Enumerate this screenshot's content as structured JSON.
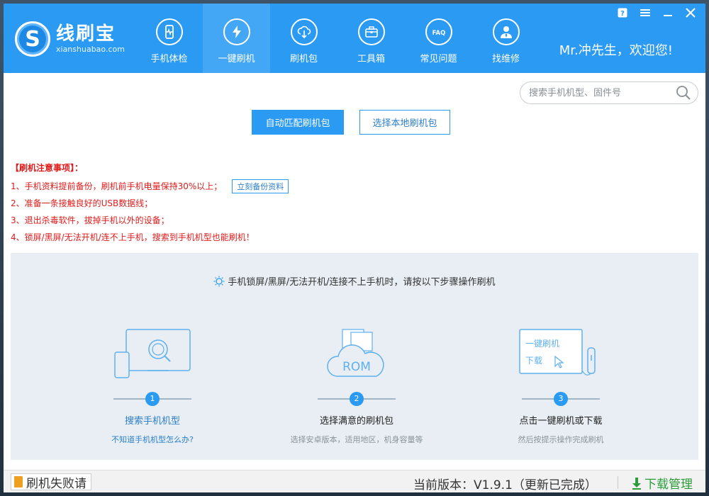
{
  "app": {
    "logo_name": "线刷宝",
    "logo_url": "xianshuabao.com",
    "welcome": "Mr.冲先生，欢迎您!"
  },
  "nav": [
    {
      "label": "手机体检",
      "icon": "phone-check-icon"
    },
    {
      "label": "一键刷机",
      "icon": "lightning-icon",
      "active": true
    },
    {
      "label": "刷机包",
      "icon": "rom-package-icon"
    },
    {
      "label": "工具箱",
      "icon": "toolbox-icon"
    },
    {
      "label": "常见问题",
      "icon": "faq-icon"
    },
    {
      "label": "找维修",
      "icon": "repair-person-icon"
    }
  ],
  "window_controls": [
    "help-icon",
    "menu-icon",
    "minimize-icon",
    "close-icon"
  ],
  "search": {
    "placeholder": "搜索手机机型、固件号"
  },
  "buttons": {
    "auto_match": "自动匹配刷机包",
    "local_package": "选择本地刷机包",
    "backup": "立刻备份资料"
  },
  "notice": {
    "title": "【刷机注意事项】：",
    "lines": [
      "1、手机资料提前备份，刷机前手机电量保持30%以上；",
      "2、准备一条接触良好的USB数据线；",
      "3、退出杀毒软件，拔掉手机以外的设备；",
      "4、锁屏/黑屏/无法开机/连不上手机，搜索到手机机型也能刷机！"
    ]
  },
  "steps_panel": {
    "tip": "手机锁屏/黑屏/无法开机/连接不上手机时，请按以下步骤操作刷机",
    "steps": [
      {
        "num": "1",
        "title": "搜索手机机型",
        "sub": "不知道手机机型怎么办?"
      },
      {
        "num": "2",
        "title": "选择满意的刷机包",
        "sub": "选择安卓版本，适用地区，机身容量等",
        "illus_text": "ROM"
      },
      {
        "num": "3",
        "title": "点击一键刷机或下载",
        "sub": "然后按提示操作完成刷机",
        "illus_text_1": "一键刷机",
        "illus_text_2": "下载"
      }
    ]
  },
  "footer": {
    "flash_fail": "刷机失败请",
    "version": "当前版本：V1.9.1（更新已完成）",
    "download_manager": "下载管理"
  },
  "colors": {
    "brand_blue": "#2b9af3",
    "notice_red": "#e01b1b",
    "download_green": "#2a9d3a"
  }
}
